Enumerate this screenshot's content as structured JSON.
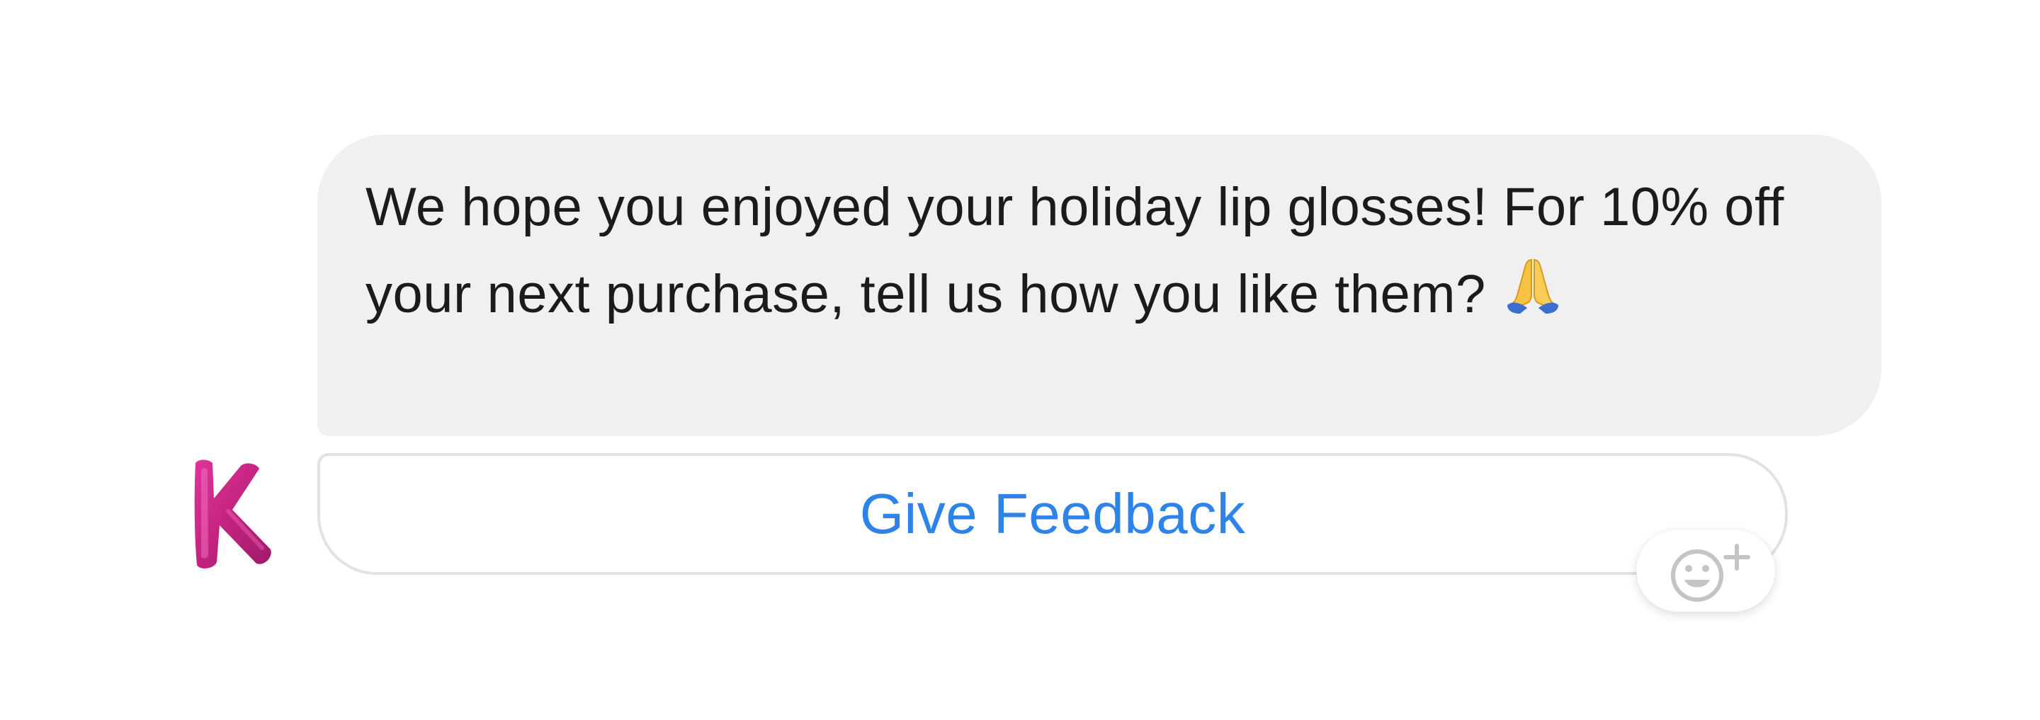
{
  "conversation": {
    "message": {
      "text": "We hope you enjoyed your holiday lip glosses! For 10% off your next purchase, tell us how you like them?",
      "emoji": "folded-hands-icon"
    },
    "sender": {
      "avatar_icon": "letter-k-logo"
    },
    "quick_reply": {
      "label": "Give Feedback"
    },
    "reaction": {
      "icon": "add-reaction-icon"
    }
  },
  "colors": {
    "bubble_background": "#f0f0f0",
    "message_text": "#1b1b1b",
    "button_text": "#2e83e8",
    "button_border": "#e2e2e2",
    "avatar": "#c8288f",
    "reaction_icon": "#c4c4c4"
  }
}
